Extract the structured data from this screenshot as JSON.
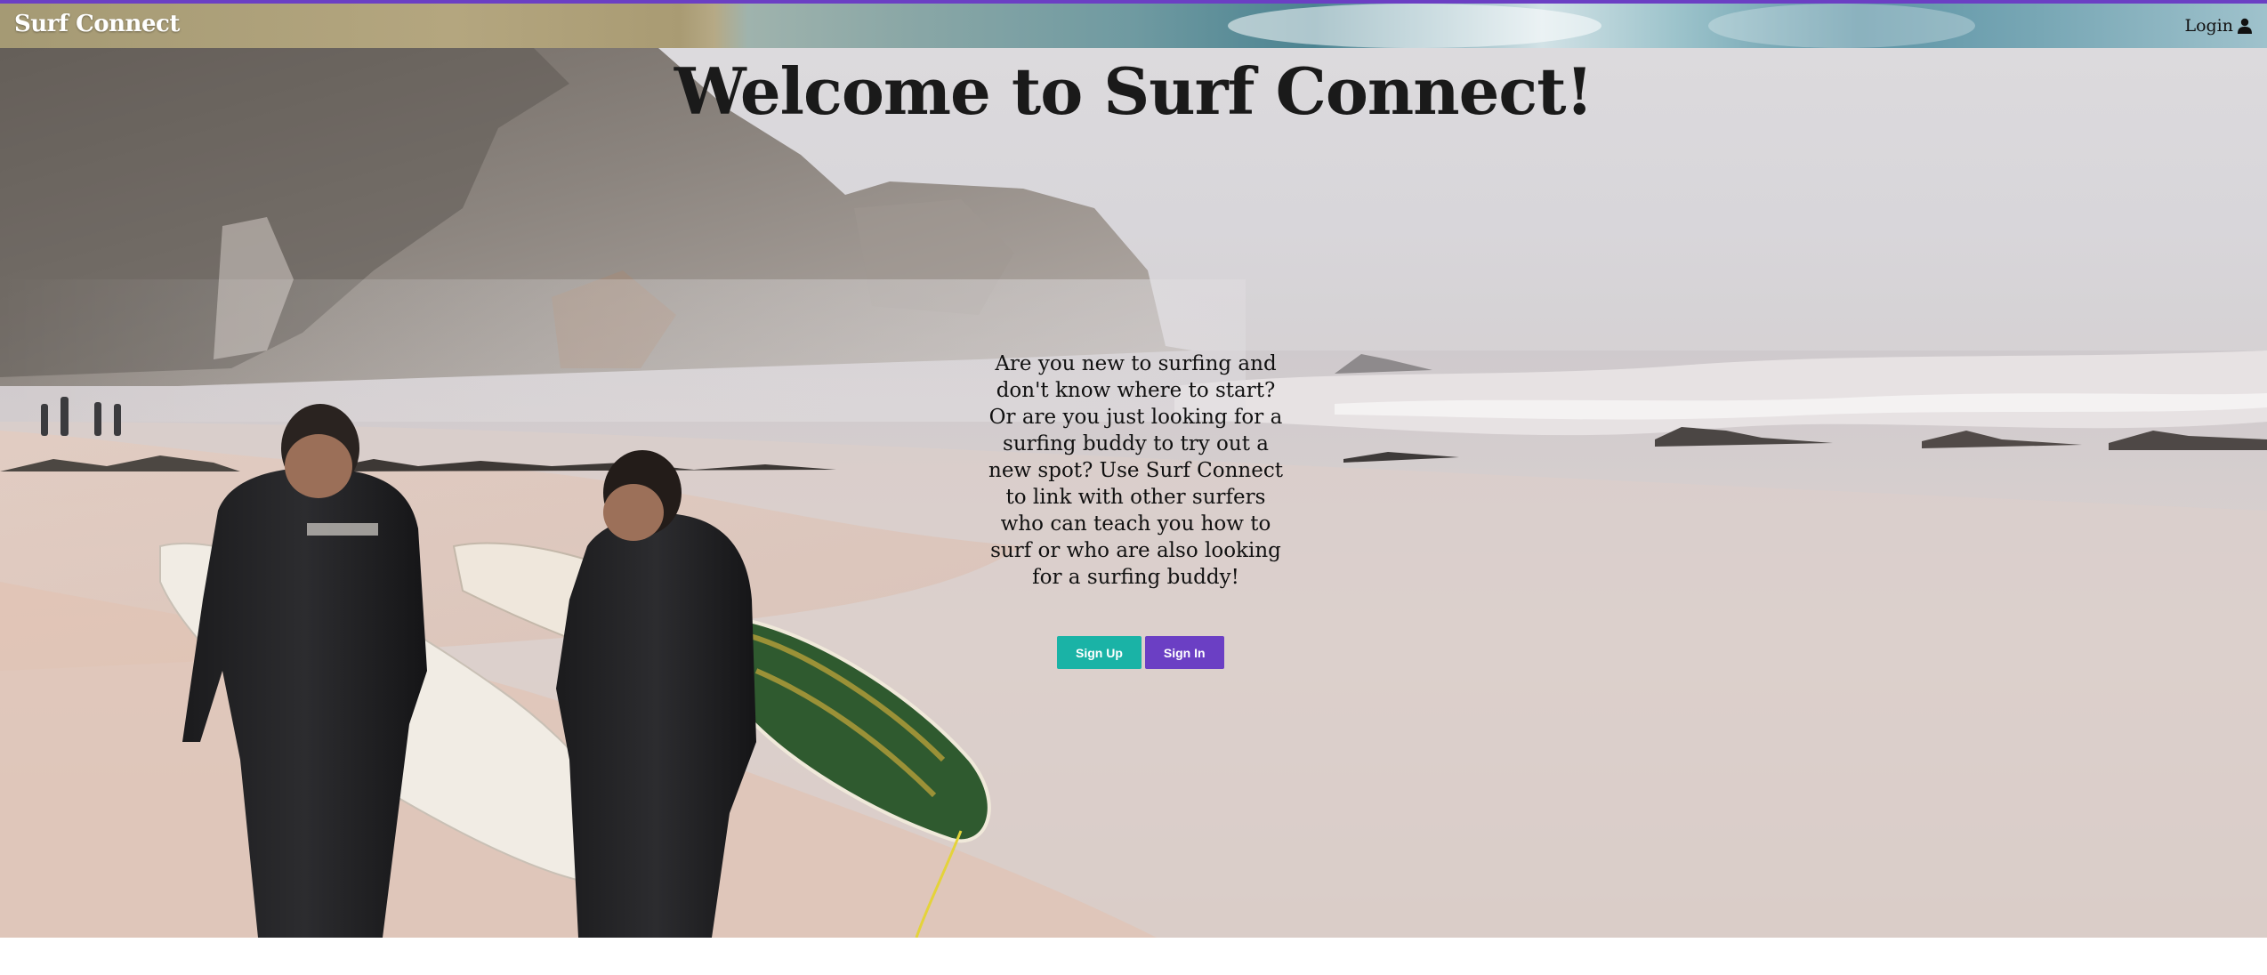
{
  "navbar": {
    "brand": "Surf Connect",
    "login_label": "Login",
    "login_icon": "user-icon"
  },
  "hero": {
    "title": "Welcome to Surf Connect!",
    "description": "Are you new to surfing and don't know where to start? Or are you just looking for a surfing buddy to try out a new spot? Use Surf Connect to link with other surfers who can teach you how to surf or who are also looking for a surfing buddy!",
    "signup_label": "Sign Up",
    "signin_label": "Sign In"
  },
  "colors": {
    "accent_purple": "#6b3fc4",
    "accent_teal": "#1ab3a6"
  }
}
